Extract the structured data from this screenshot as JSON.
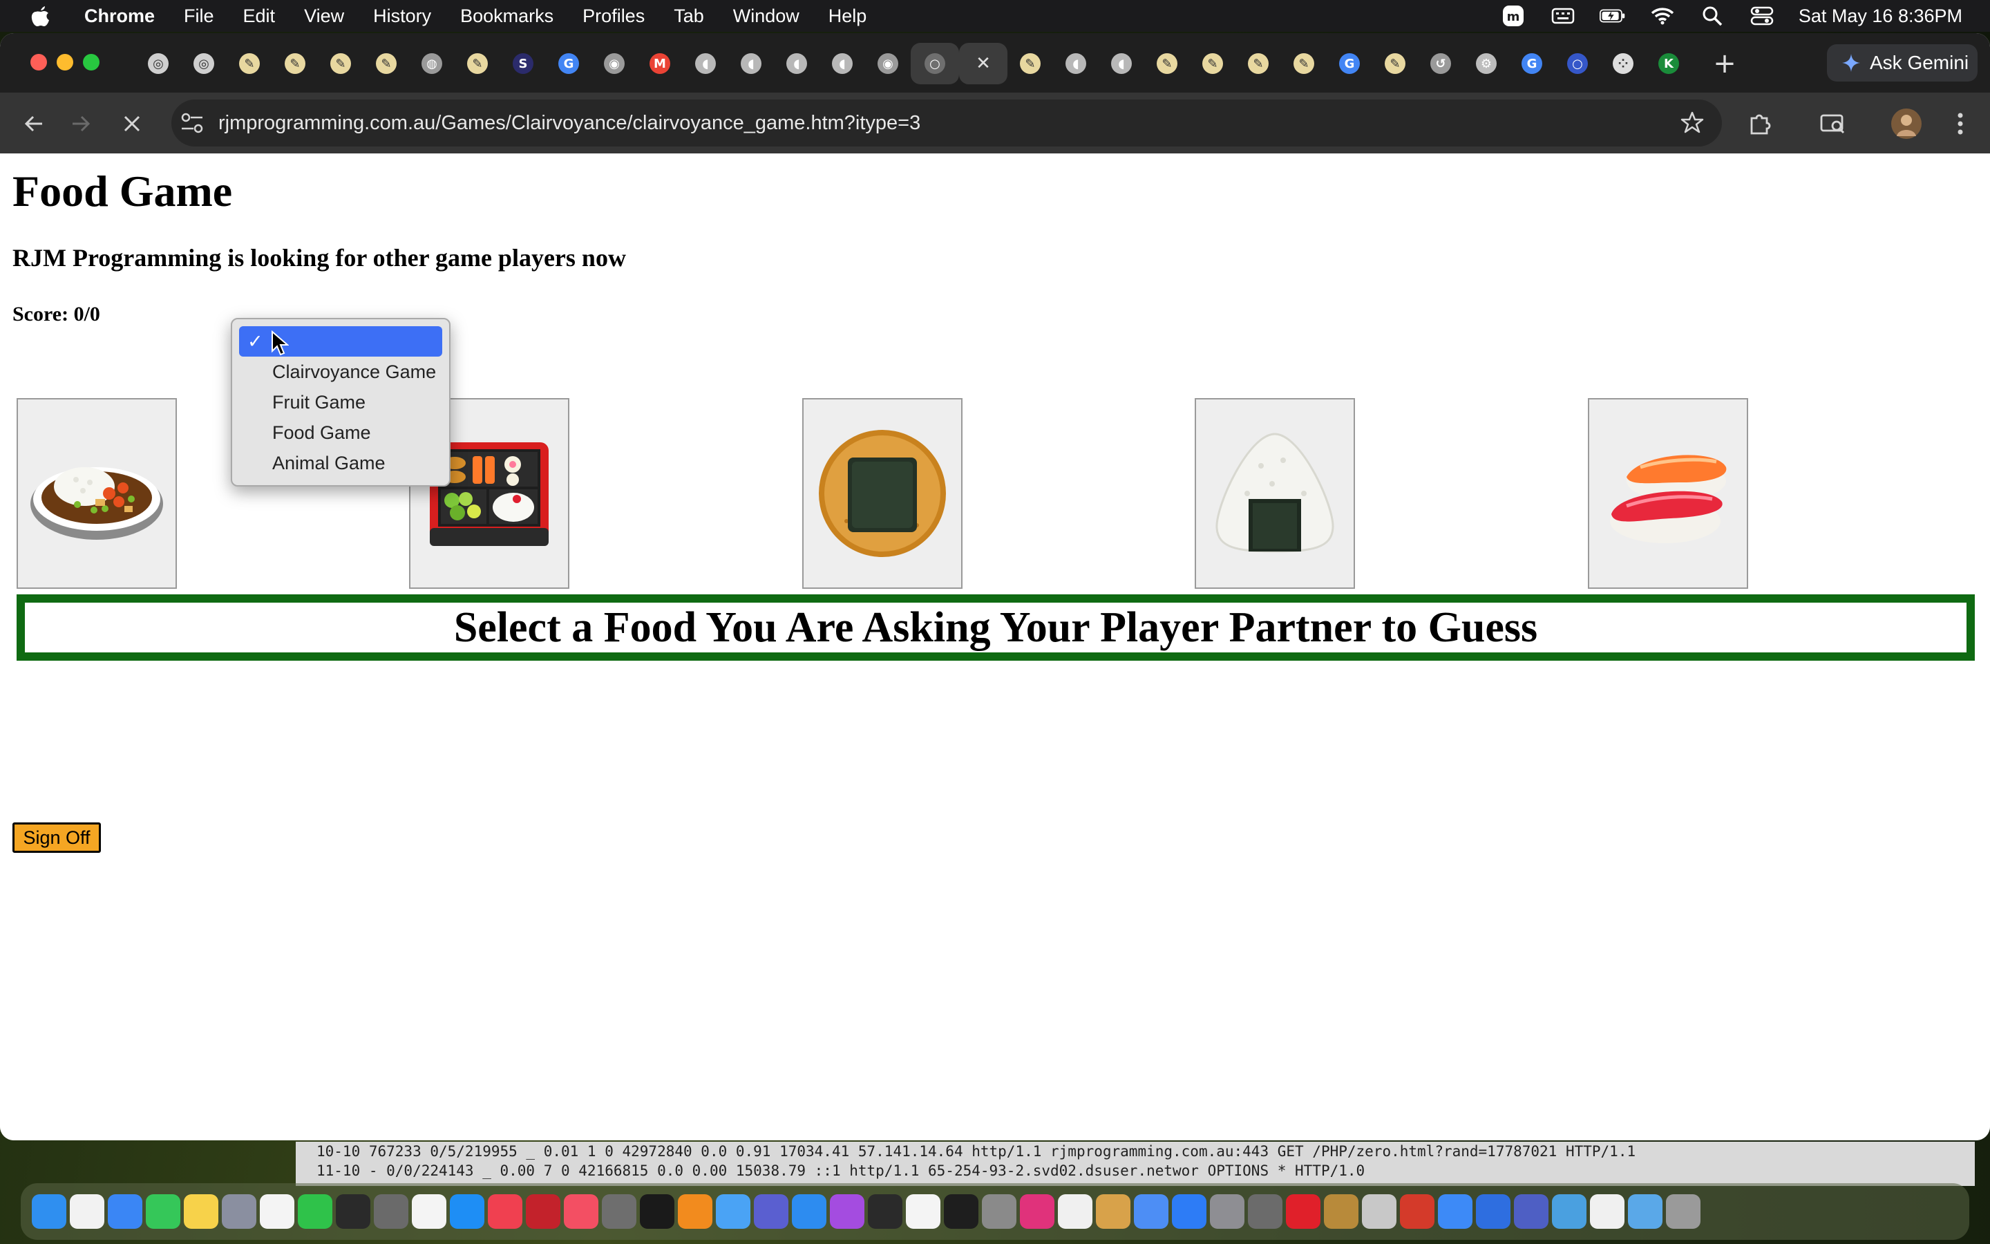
{
  "menubar": {
    "app_name": "Chrome",
    "items": [
      "File",
      "Edit",
      "View",
      "History",
      "Bookmarks",
      "Profiles",
      "Tab",
      "Window",
      "Help"
    ],
    "datetime": "Sat May 16  8:36PM"
  },
  "browser": {
    "url": "rjmprogramming.com.au/Games/Clairvoyance/clairvoyance_game.htm?itype=3",
    "ask_gemini_label": "Ask Gemini",
    "tab_favicons": [
      {
        "icon": "compass-icon",
        "color": "#cfcfcf",
        "glyph": "◎"
      },
      {
        "icon": "compass-icon",
        "color": "#cfcfcf",
        "glyph": "◎"
      },
      {
        "icon": "rjm-pencil-icon",
        "color": "#e8d8a0",
        "glyph": "✎"
      },
      {
        "icon": "rjm-pencil-icon",
        "color": "#e8d8a0",
        "glyph": "✎"
      },
      {
        "icon": "rjm-pencil-icon",
        "color": "#e8d8a0",
        "glyph": "✎"
      },
      {
        "icon": "rjm-pencil-icon",
        "color": "#e8d8a0",
        "glyph": "✎"
      },
      {
        "icon": "globe-icon",
        "color": "#9a9a9a",
        "glyph": "◍"
      },
      {
        "icon": "rjm-pencil-icon",
        "color": "#e8d8a0",
        "glyph": "✎"
      },
      {
        "icon": "s-icon",
        "color": "#2b2b6b",
        "glyph": "S"
      },
      {
        "icon": "google-icon",
        "color": "#4285f4",
        "glyph": "G"
      },
      {
        "icon": "chrome-icon",
        "color": "#9a9a9a",
        "glyph": "◉"
      },
      {
        "icon": "gmail-icon",
        "color": "#ea4335",
        "glyph": "M"
      },
      {
        "icon": "elephant-icon",
        "color": "#b8b8b8",
        "glyph": "◖"
      },
      {
        "icon": "elephant-icon",
        "color": "#b8b8b8",
        "glyph": "◖"
      },
      {
        "icon": "elephant-icon",
        "color": "#b8b8b8",
        "glyph": "◖"
      },
      {
        "icon": "elephant-icon",
        "color": "#b8b8b8",
        "glyph": "◖"
      },
      {
        "icon": "chrome-icon",
        "color": "#9a9a9a",
        "glyph": "◉"
      },
      {
        "icon": "loading-icon",
        "color": "#6f6f6f",
        "glyph": "○",
        "active": true
      },
      {
        "icon": "close-icon",
        "color": "#3c3c3c",
        "glyph": "✕",
        "active": true
      },
      {
        "icon": "rjm-pencil-icon",
        "color": "#e8d8a0",
        "glyph": "✎"
      },
      {
        "icon": "elephant-icon",
        "color": "#b8b8b8",
        "glyph": "◖"
      },
      {
        "icon": "elephant-icon",
        "color": "#b8b8b8",
        "glyph": "◖"
      },
      {
        "icon": "rjm-pencil-icon",
        "color": "#e8d8a0",
        "glyph": "✎"
      },
      {
        "icon": "rjm-pencil-icon",
        "color": "#e8d8a0",
        "glyph": "✎"
      },
      {
        "icon": "rjm-pencil-icon",
        "color": "#e8d8a0",
        "glyph": "✎"
      },
      {
        "icon": "rjm-pencil-icon",
        "color": "#e8d8a0",
        "glyph": "✎"
      },
      {
        "icon": "google-icon",
        "color": "#4285f4",
        "glyph": "G"
      },
      {
        "icon": "rjm-pencil-icon",
        "color": "#e8d8a0",
        "glyph": "✎"
      },
      {
        "icon": "history-icon",
        "color": "#9a9a9a",
        "glyph": "↺"
      },
      {
        "icon": "gear-icon",
        "color": "#bdbdbd",
        "glyph": "⚙"
      },
      {
        "icon": "google-icon",
        "color": "#4285f4",
        "glyph": "G"
      },
      {
        "icon": "circle-icon",
        "color": "#3557c9",
        "glyph": "○"
      },
      {
        "icon": "dots-icon",
        "color": "#dddddd",
        "glyph": "⁘"
      },
      {
        "icon": "k-icon",
        "color": "#1a8c3a",
        "glyph": "K"
      }
    ]
  },
  "page": {
    "title": "Food Game",
    "status": "RJM Programming is looking for other game players now",
    "score": "Score: 0/0",
    "foods": [
      {
        "name": "curry-rice",
        "icon": "curry-rice-icon"
      },
      {
        "name": "bento-box",
        "icon": "bento-box-icon"
      },
      {
        "name": "rice-cracker",
        "icon": "rice-cracker-icon"
      },
      {
        "name": "rice-ball",
        "icon": "rice-ball-icon"
      },
      {
        "name": "sushi",
        "icon": "sushi-icon"
      }
    ],
    "prompt": "Select a Food You Are Asking Your Player Partner to Guess",
    "sign_off_label": "Sign Off"
  },
  "dropdown": {
    "selected_value": "",
    "options": [
      "",
      "Clairvoyance Game",
      "Fruit Game",
      "Food Game",
      "Animal Game"
    ]
  },
  "terminal": {
    "lines": [
      "10-10  767233 0/5/219955    _  0.01 1      0      42972840 0.0      0.91   17034.41 57.141.14.64      http/1.1  rjmprogramming.com.au:443     GET /PHP/zero.html?rand=17787021 HTTP/1.1",
      "11-10  -      0/0/224143    _  0.00 7      0      42166815 0.0      0.00   15038.79 ::1               http/1.1  65-254-93-2.svd02.dsuser.networ OPTIONS * HTTP/1.0"
    ]
  },
  "dock": {
    "icons": [
      {
        "name": "finder-icon",
        "color": "#2f8ff0"
      },
      {
        "name": "reminders-icon",
        "color": "#f2f2f2"
      },
      {
        "name": "mail-icon",
        "color": "#3a86f5"
      },
      {
        "name": "messages-icon",
        "color": "#35c759"
      },
      {
        "name": "notes-icon",
        "color": "#f7d24a"
      },
      {
        "name": "launchpad-icon",
        "color": "#8a8fa0"
      },
      {
        "name": "freeform-icon",
        "color": "#f4f4f4"
      },
      {
        "name": "facetime-icon",
        "color": "#2fc24a"
      },
      {
        "name": "terminal-icon",
        "color": "#2a2a2a"
      },
      {
        "name": "calculator-icon",
        "color": "#6a6a6a"
      },
      {
        "name": "textedit-icon",
        "color": "#f4f4f4"
      },
      {
        "name": "appstore-icon",
        "color": "#1e8ef5"
      },
      {
        "name": "news-icon",
        "color": "#f04050"
      },
      {
        "name": "filezilla-icon",
        "color": "#c3222b"
      },
      {
        "name": "music-icon",
        "color": "#f34f63"
      },
      {
        "name": "rat-icon",
        "color": "#6e6e6e"
      },
      {
        "name": "appletv-icon",
        "color": "#1a1a1a"
      },
      {
        "name": "firefox-icon",
        "color": "#f28b1e"
      },
      {
        "name": "safari-helper-icon",
        "color": "#4aa3f5"
      },
      {
        "name": "bbedit-icon",
        "color": "#5a5fd0"
      },
      {
        "name": "safari-icon",
        "color": "#2d8cf0"
      },
      {
        "name": "podcasts-icon",
        "color": "#a44ce0"
      },
      {
        "name": "console-icon",
        "color": "#2a2a2a"
      },
      {
        "name": "calendar-icon",
        "color": "#f4f4f4"
      },
      {
        "name": "terminal2-icon",
        "color": "#1e1e1e"
      },
      {
        "name": "magnifier-icon",
        "color": "#8a8a8a"
      },
      {
        "name": "intellij-icon",
        "color": "#e0327b"
      },
      {
        "name": "preview-icon",
        "color": "#f0f0f0"
      },
      {
        "name": "chrome-helper-icon",
        "color": "#d8a24a"
      },
      {
        "name": "chrome-dock-icon",
        "color": "#4d8ef5"
      },
      {
        "name": "zoom-icon",
        "color": "#2d7cf6"
      },
      {
        "name": "settings-icon",
        "color": "#8e8e93"
      },
      {
        "name": "gimp-icon",
        "color": "#6b6b6b"
      },
      {
        "name": "opera-icon",
        "color": "#e0202a"
      },
      {
        "name": "archive-icon",
        "color": "#b88a3a"
      },
      {
        "name": "elephant-dock-icon",
        "color": "#c8c8c8"
      },
      {
        "name": "compass-dock-icon",
        "color": "#d43a2a"
      },
      {
        "name": "xcode-icon",
        "color": "#3d8af7"
      },
      {
        "name": "windows-icon",
        "color": "#2e6ee0"
      },
      {
        "name": "teams-icon",
        "color": "#4e5fc4"
      },
      {
        "name": "keychain-icon",
        "color": "#4aa0e0"
      },
      {
        "name": "file-icon",
        "color": "#f0f0f0"
      },
      {
        "name": "folder-icon",
        "color": "#5aa8e8"
      },
      {
        "name": "trash-icon",
        "color": "#9a9a9a"
      }
    ]
  }
}
